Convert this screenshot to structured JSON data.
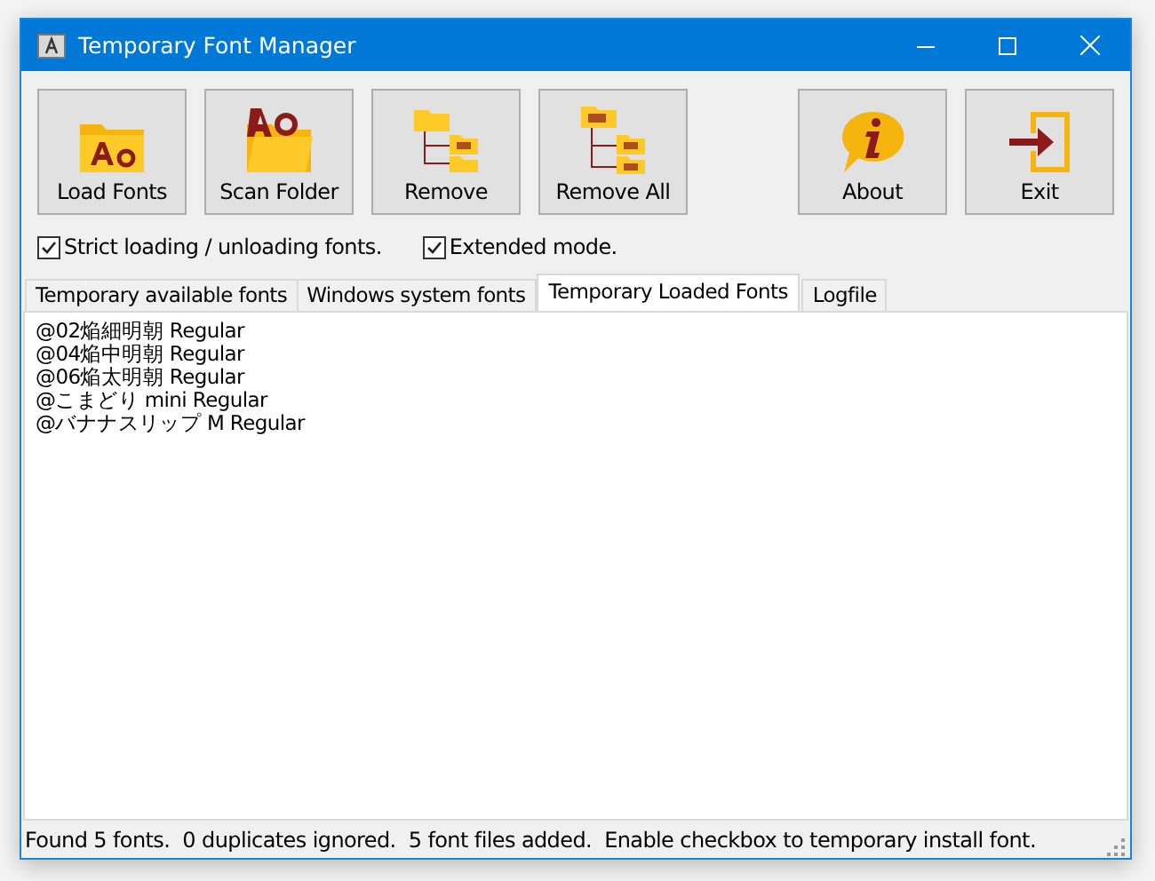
{
  "window": {
    "title": "Temporary Font Manager"
  },
  "toolbar": [
    {
      "label": "Load Fonts"
    },
    {
      "label": "Scan Folder"
    },
    {
      "label": "Remove"
    },
    {
      "label": "Remove All"
    },
    {
      "label": "About"
    },
    {
      "label": "Exit"
    }
  ],
  "options": [
    {
      "label": "Strict loading / unloading fonts.",
      "checked": true
    },
    {
      "label": "Extended mode.",
      "checked": true
    }
  ],
  "tabs": [
    {
      "label": "Temporary available fonts",
      "selected": false
    },
    {
      "label": "Windows system fonts",
      "selected": false
    },
    {
      "label": "Temporary Loaded Fonts",
      "selected": true
    },
    {
      "label": "Logfile",
      "selected": false
    }
  ],
  "font_list": [
    "@02焔細明朝 Regular",
    "@04焔中明朝 Regular",
    "@06焔太明朝 Regular",
    "@こまどり mini Regular",
    "@バナナスリップ M Regular"
  ],
  "status_bar": "Found 5 fonts.  0 duplicates ignored.  5 font files added.  Enable checkbox to temporary install font."
}
